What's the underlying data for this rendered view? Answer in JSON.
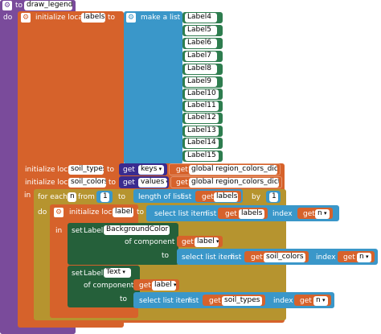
{
  "procedure": {
    "to": "to",
    "name": "draw_legend",
    "do": "do"
  },
  "outer_local": {
    "label": "initialize local",
    "var": "labels",
    "to": "to"
  },
  "make_list": {
    "label": "make a list",
    "items": [
      "Label4",
      "Label5",
      "Label6",
      "Label7",
      "Label8",
      "Label9",
      "Label10",
      "Label11",
      "Label12",
      "Label13",
      "Label14",
      "Label15"
    ]
  },
  "local2": {
    "label": "initialize local",
    "var": "soil_types",
    "to": "to",
    "get": "get",
    "key": "keys",
    "get2": "get",
    "global": "global region_colors_dict"
  },
  "local3": {
    "label": "initialize local",
    "var": "soil_colors",
    "to": "to",
    "get": "get",
    "key": "values",
    "get2": "get",
    "global": "global region_colors_dict"
  },
  "in_label": "in",
  "for_each": {
    "label": "for each",
    "var": "n",
    "from": "from",
    "from_val": "1",
    "to": "to",
    "length": "length of list",
    "list": "list",
    "get": "get",
    "get_var": "labels",
    "by": "by",
    "by_val": "1"
  },
  "do_label": "do",
  "local4": {
    "label": "initialize local",
    "var": "label",
    "to": "to",
    "select": "select list item",
    "list": "list",
    "get": "get",
    "get_var": "labels",
    "index": "index",
    "get_idx": "get",
    "idx_var": "n"
  },
  "in_label2": "in",
  "set_bg": {
    "set": "set",
    "comp": "Label.",
    "prop": "BackgroundColor",
    "of": "of component",
    "get": "get",
    "get_var": "label",
    "to": "to",
    "select": "select list item",
    "list": "list",
    "get2": "get",
    "get2_var": "soil_colors",
    "index": "index",
    "get3": "get",
    "idx_var": "n"
  },
  "set_text": {
    "set": "set",
    "comp": "Label.",
    "prop": "Text",
    "of": "of component",
    "get": "get",
    "get_var": "label",
    "to": "to",
    "select": "select list item",
    "list": "list",
    "get2": "get",
    "get2_var": "soil_types",
    "index": "index",
    "get3": "get",
    "idx_var": "n"
  }
}
